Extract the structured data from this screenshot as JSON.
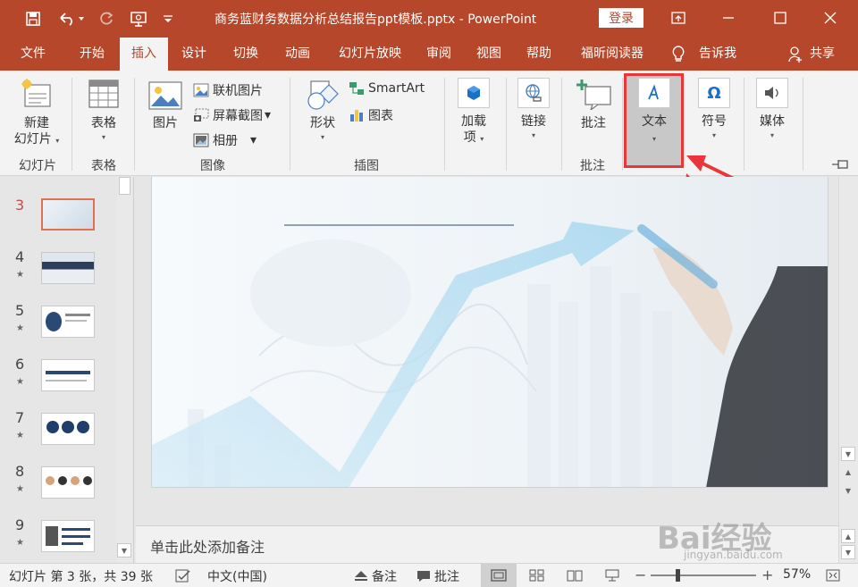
{
  "title": {
    "document": "商务蓝财务数据分析总结报告ppt模板.pptx  -  PowerPoint",
    "login": "登录"
  },
  "tabs": [
    "文件",
    "开始",
    "插入",
    "设计",
    "切换",
    "动画",
    "幻灯片放映",
    "审阅",
    "视图",
    "帮助",
    "福昕阅读器",
    "告诉我",
    "共享"
  ],
  "ribbon": {
    "new_slide": [
      "新建",
      "幻灯片"
    ],
    "table": "表格",
    "picture": "图片",
    "online_picture": "联机图片",
    "screenshot": "屏幕截图",
    "album": "相册",
    "shapes": "形状",
    "smartart": "SmartArt",
    "chart": "图表",
    "addins": [
      "加载",
      "项"
    ],
    "link": "链接",
    "comment": "批注",
    "text": "文本",
    "symbol": "符号",
    "media": "媒体",
    "groups": {
      "slides": "幻灯片",
      "tables": "表格",
      "images": "图像",
      "illustrations": "插图",
      "comments": "批注"
    }
  },
  "tooltip": "文本",
  "thumbnails": [
    {
      "num": "3",
      "star": ""
    },
    {
      "num": "4",
      "star": "★"
    },
    {
      "num": "5",
      "star": "★"
    },
    {
      "num": "6",
      "star": "★"
    },
    {
      "num": "7",
      "star": "★"
    },
    {
      "num": "8",
      "star": "★"
    },
    {
      "num": "9",
      "star": "★"
    }
  ],
  "notes_placeholder": "单击此处添加备注",
  "status": {
    "slide_info": "幻灯片 第 3 张，共 39 张",
    "language": "中文(中国)",
    "notes": "备注",
    "comments": "批注",
    "zoom": "57%"
  },
  "watermark": {
    "brand": "Bai经验",
    "url": "jingyan.baidu.com"
  },
  "colors": {
    "accent": "#b7472a",
    "highlight": "#e8363a"
  }
}
